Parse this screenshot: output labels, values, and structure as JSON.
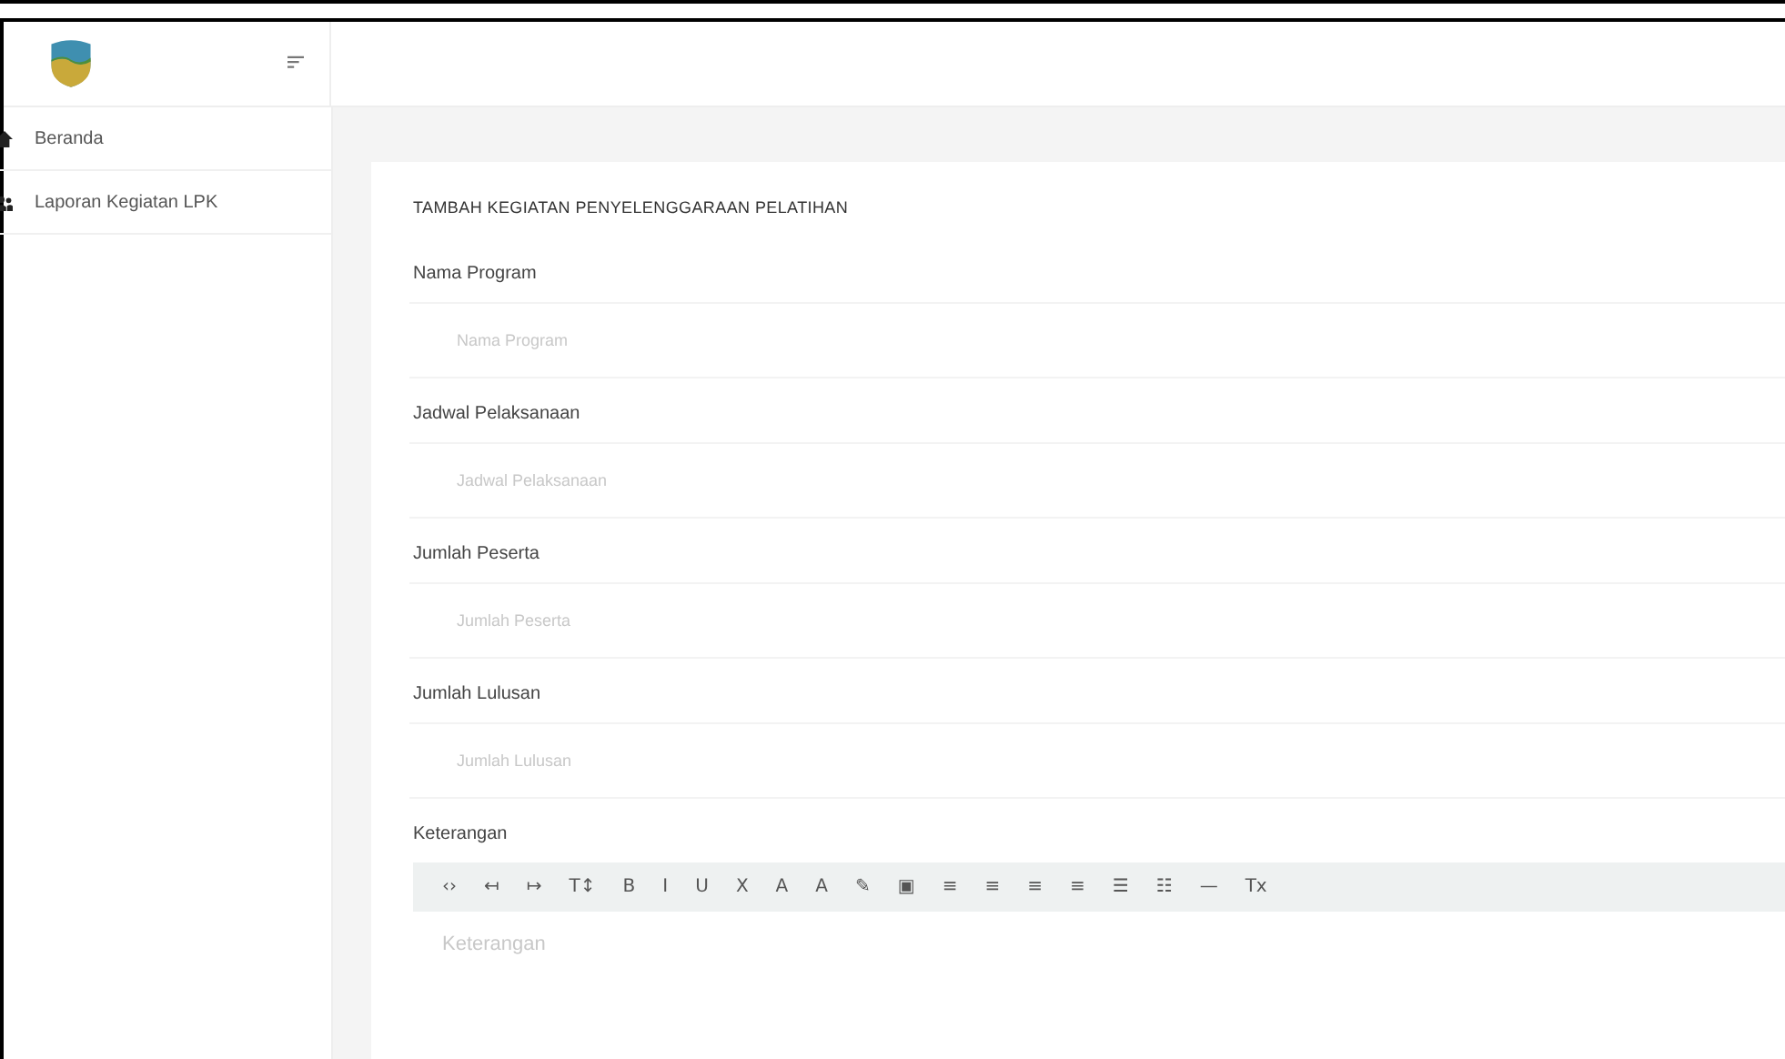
{
  "sidebar": {
    "items": [
      {
        "label": "Beranda",
        "kind": "home"
      },
      {
        "label": "Laporan Kegiatan LPK",
        "kind": "people"
      }
    ]
  },
  "form": {
    "title": "TAMBAH KEGIATAN PENYELENGGARAAN PELATIHAN",
    "fields": [
      {
        "label": "Nama Program",
        "placeholder": "Nama Program"
      },
      {
        "label": "Jadwal Pelaksanaan",
        "placeholder": "Jadwal Pelaksanaan"
      },
      {
        "label": "Jumlah Peserta",
        "placeholder": "Jumlah Peserta"
      },
      {
        "label": "Jumlah Lulusan",
        "placeholder": "Jumlah Lulusan"
      }
    ],
    "editor": {
      "label": "Keterangan",
      "placeholder": "Keterangan",
      "toolbar": [
        "‹›",
        "↤",
        "↦",
        "T↕",
        "B",
        "I",
        "U",
        "X",
        "A",
        "A",
        "✎",
        "▣",
        "≡",
        "≡",
        "≡",
        "≡",
        "☰",
        "☷",
        "—",
        "Tx"
      ]
    }
  }
}
